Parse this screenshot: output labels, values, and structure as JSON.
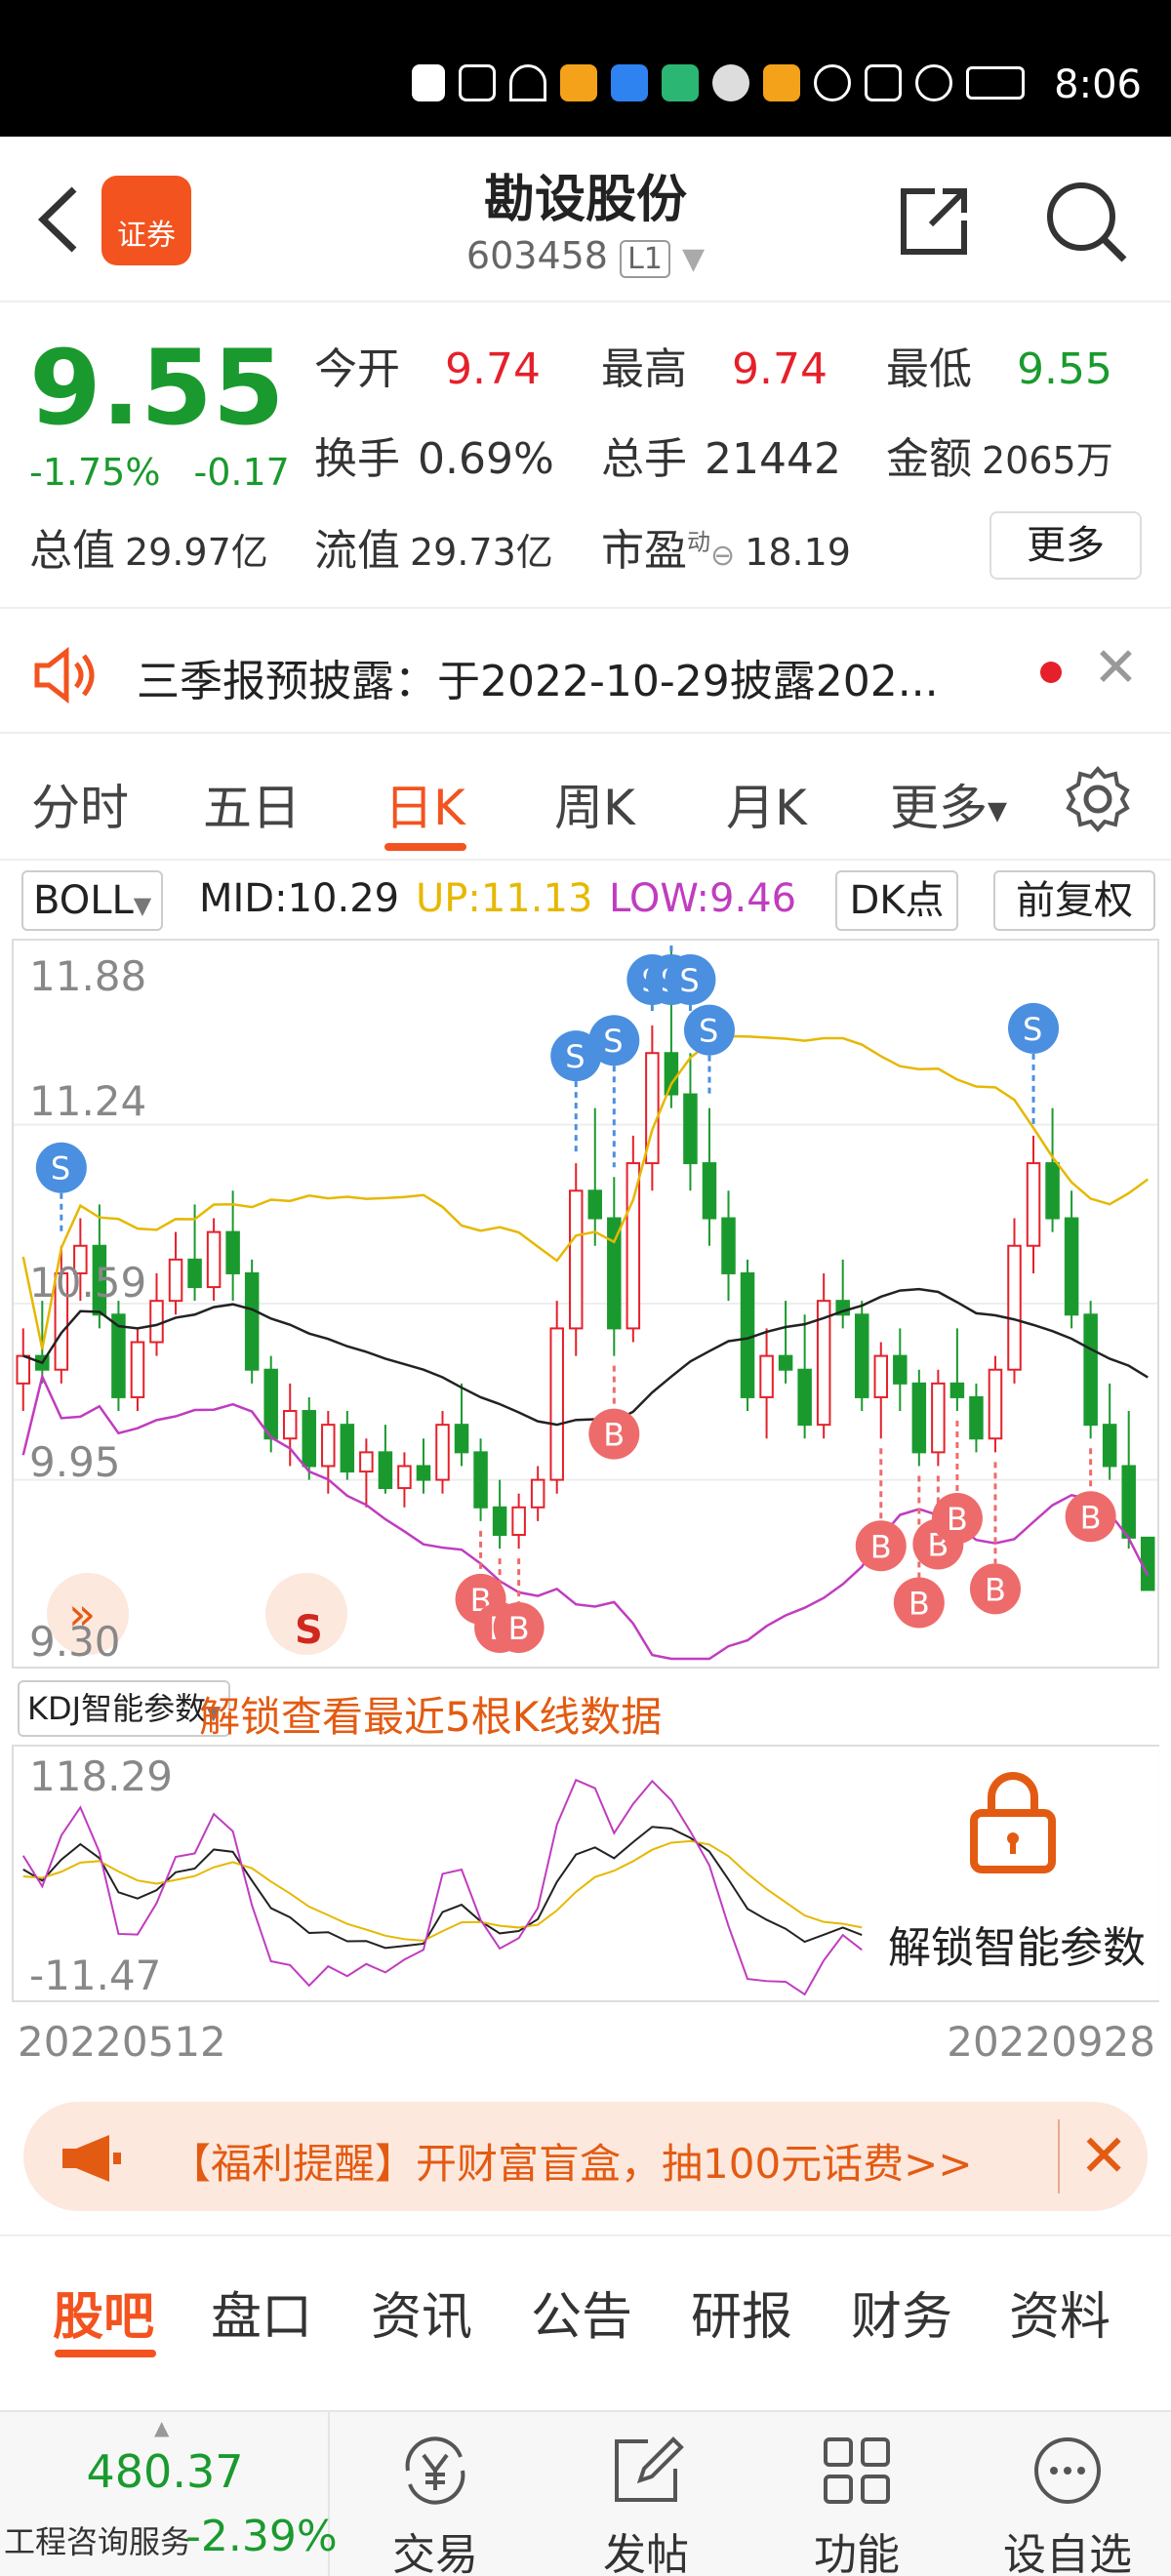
{
  "status_bar": {
    "time": "8:06"
  },
  "header": {
    "app_logo_text": "证券",
    "stock_name": "勘设股份",
    "stock_code": "603458",
    "level": "L1"
  },
  "quote": {
    "price": "9.55",
    "change_pct": "-1.75%",
    "change_abs": "-0.17",
    "open_label": "今开",
    "open": "9.74",
    "high_label": "最高",
    "high": "9.74",
    "low_label": "最低",
    "low": "9.55",
    "turnover_label": "换手",
    "turnover": "0.69%",
    "volume_label": "总手",
    "volume": "21442",
    "amount_label": "金额",
    "amount": "2065万",
    "mktcap_label": "总值",
    "mktcap": "29.97亿",
    "float_label": "流值",
    "float": "29.73亿",
    "pe_label": "市盈",
    "pe_sup": "动",
    "pe": "18.19",
    "more_label": "更多"
  },
  "notice": {
    "text": "三季报预披露：于2022-10-29披露202..."
  },
  "tabs": [
    "分时",
    "五日",
    "日K",
    "周K",
    "月K",
    "更多"
  ],
  "indicator": {
    "name": "BOLL",
    "mid": "MID:10.29",
    "up": "UP:11.13",
    "low": "LOW:9.46",
    "dk_label": "DK点",
    "fq_label": "前复权"
  },
  "chart_labels": {
    "y_ticks": [
      "11.88",
      "11.24",
      "10.59",
      "9.95",
      "9.30"
    ],
    "buy": "B",
    "sell": "S"
  },
  "kdj": {
    "name": "KDJ智能参数",
    "unlock_text": "解锁查看最近5根K线数据",
    "y_top": "118.29",
    "y_bottom": "-11.47",
    "overlay_text": "解锁智能参数"
  },
  "dates": {
    "start": "20220512",
    "end": "20220928"
  },
  "promo": {
    "text": "【福利提醒】开财富盲盒，抽100元话费>>"
  },
  "subtabs": [
    "股吧",
    "盘口",
    "资讯",
    "公告",
    "研报",
    "财务",
    "资料"
  ],
  "bottom": {
    "index_value": "480.37",
    "index_name": "工程咨询服务",
    "index_change": "-2.39%",
    "nav": [
      "交易",
      "发帖",
      "功能",
      "设自选"
    ]
  },
  "colors": {
    "accent": "#f3531f",
    "up": "#e5202a",
    "down": "#1a9a2e",
    "boll_up": "#e6b800",
    "boll_low": "#c03cc0",
    "buy_marker": "#ee6b6b",
    "sell_marker": "#4a8fe0"
  },
  "chart_data": {
    "type": "candlestick",
    "title": "",
    "indicator": "BOLL",
    "boll": {
      "mid": 10.29,
      "up": 11.13,
      "low": 9.46
    },
    "ylim": [
      9.3,
      11.88
    ],
    "x_range": [
      "20220512",
      "20220928"
    ],
    "candles": [
      [
        10.3,
        10.5,
        10.2,
        10.4
      ],
      [
        10.4,
        10.6,
        10.3,
        10.35
      ],
      [
        10.35,
        10.8,
        10.3,
        10.7
      ],
      [
        10.7,
        10.9,
        10.6,
        10.8
      ],
      [
        10.8,
        10.95,
        10.5,
        10.55
      ],
      [
        10.55,
        10.6,
        10.2,
        10.25
      ],
      [
        10.25,
        10.5,
        10.2,
        10.45
      ],
      [
        10.45,
        10.7,
        10.4,
        10.6
      ],
      [
        10.6,
        10.85,
        10.55,
        10.75
      ],
      [
        10.75,
        10.95,
        10.6,
        10.65
      ],
      [
        10.65,
        10.9,
        10.6,
        10.85
      ],
      [
        10.85,
        11.0,
        10.6,
        10.7
      ],
      [
        10.7,
        10.75,
        10.3,
        10.35
      ],
      [
        10.35,
        10.4,
        10.05,
        10.1
      ],
      [
        10.1,
        10.3,
        10.0,
        10.2
      ],
      [
        10.2,
        10.25,
        9.95,
        10.0
      ],
      [
        10.0,
        10.2,
        9.9,
        10.15
      ],
      [
        10.15,
        10.2,
        9.95,
        9.98
      ],
      [
        9.98,
        10.1,
        9.85,
        10.05
      ],
      [
        10.05,
        10.15,
        9.9,
        9.92
      ],
      [
        9.92,
        10.05,
        9.85,
        10.0
      ],
      [
        10.0,
        10.1,
        9.9,
        9.95
      ],
      [
        9.95,
        10.2,
        9.9,
        10.15
      ],
      [
        10.15,
        10.3,
        10.0,
        10.05
      ],
      [
        10.05,
        10.1,
        9.8,
        9.85
      ],
      [
        9.85,
        9.95,
        9.7,
        9.75
      ],
      [
        9.75,
        9.9,
        9.7,
        9.85
      ],
      [
        9.85,
        10.0,
        9.8,
        9.95
      ],
      [
        9.95,
        10.6,
        9.9,
        10.5
      ],
      [
        10.5,
        11.1,
        10.4,
        11.0
      ],
      [
        11.0,
        11.3,
        10.8,
        10.9
      ],
      [
        10.9,
        11.05,
        10.4,
        10.5
      ],
      [
        10.5,
        11.2,
        10.45,
        11.1
      ],
      [
        11.1,
        11.6,
        11.0,
        11.5
      ],
      [
        11.5,
        11.88,
        11.3,
        11.35
      ],
      [
        11.35,
        11.5,
        11.0,
        11.1
      ],
      [
        11.1,
        11.3,
        10.8,
        10.9
      ],
      [
        10.9,
        11.0,
        10.6,
        10.7
      ],
      [
        10.7,
        10.75,
        10.2,
        10.25
      ],
      [
        10.25,
        10.5,
        10.1,
        10.4
      ],
      [
        10.4,
        10.6,
        10.3,
        10.35
      ],
      [
        10.35,
        10.55,
        10.1,
        10.15
      ],
      [
        10.15,
        10.7,
        10.1,
        10.6
      ],
      [
        10.6,
        10.75,
        10.5,
        10.55
      ],
      [
        10.55,
        10.6,
        10.2,
        10.25
      ],
      [
        10.25,
        10.45,
        10.1,
        10.4
      ],
      [
        10.4,
        10.5,
        10.2,
        10.3
      ],
      [
        10.3,
        10.35,
        10.0,
        10.05
      ],
      [
        10.05,
        10.35,
        10.0,
        10.3
      ],
      [
        10.3,
        10.5,
        10.2,
        10.25
      ],
      [
        10.25,
        10.3,
        10.05,
        10.1
      ],
      [
        10.1,
        10.4,
        10.05,
        10.35
      ],
      [
        10.35,
        10.9,
        10.3,
        10.8
      ],
      [
        10.8,
        11.2,
        10.7,
        11.1
      ],
      [
        11.1,
        11.3,
        10.85,
        10.9
      ],
      [
        10.9,
        11.0,
        10.5,
        10.55
      ],
      [
        10.55,
        10.6,
        10.1,
        10.15
      ],
      [
        10.15,
        10.3,
        9.95,
        10.0
      ],
      [
        10.0,
        10.2,
        9.7,
        9.74
      ],
      [
        9.74,
        9.74,
        9.55,
        9.55
      ]
    ],
    "buy_signals": 10,
    "sell_signals": 8
  }
}
